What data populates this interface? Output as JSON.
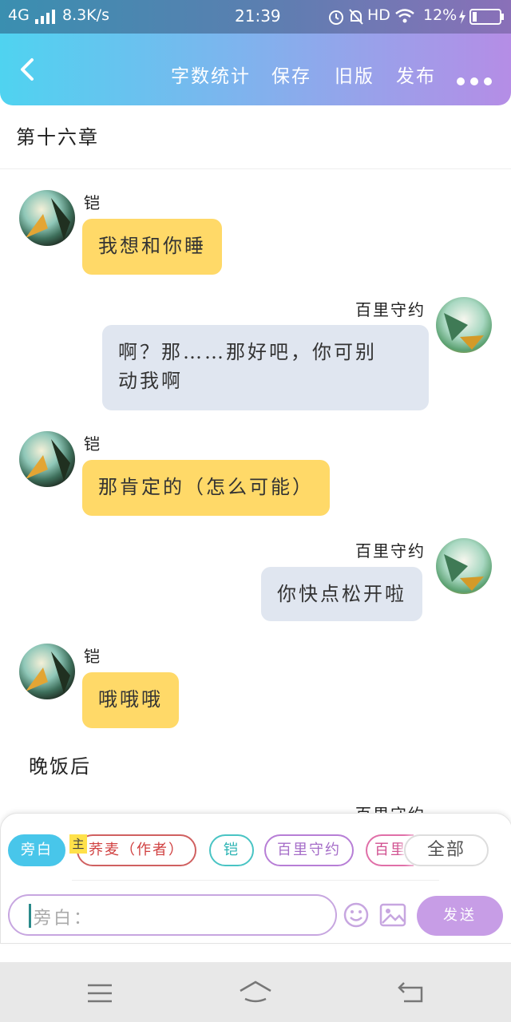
{
  "status_bar": {
    "network": "4G",
    "speed": "8.3K/s",
    "time": "21:39",
    "hd": "HD",
    "battery": "12%"
  },
  "header": {
    "actions": [
      "字数统计",
      "保存",
      "旧版",
      "发布"
    ]
  },
  "chapter_title": "第十六章",
  "messages": [
    {
      "side": "left",
      "name": "铠",
      "text": "我想和你睡"
    },
    {
      "side": "right",
      "name": "百里守约",
      "text_line1": "啊？那……那好吧，你可别",
      "text_line2": "动我啊"
    },
    {
      "side": "left",
      "name": "铠",
      "text": "那肯定的（怎么可能）"
    },
    {
      "side": "right",
      "name": "百里守约",
      "text": "你快点松开啦"
    },
    {
      "side": "left",
      "name": "铠",
      "text": "哦哦哦"
    }
  ],
  "narration": "晚饭后",
  "partial_next_name": "百里守约",
  "role_chips": {
    "narrator": "旁白",
    "author": "荞麦（作者）",
    "author_badge": "主",
    "kai": "铠",
    "baili": "百里守约",
    "baili2": "百里",
    "all": "全部"
  },
  "input": {
    "placeholder": "旁白："
  },
  "send_label": "发送",
  "colors": {
    "left_bubble": "#ffd968",
    "right_bubble": "#e0e6f0",
    "accent": "#c79de6"
  }
}
